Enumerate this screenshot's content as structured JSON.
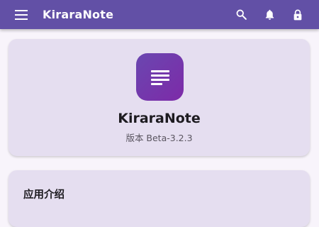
{
  "app_bar": {
    "title": "KiraraNote",
    "background": "#6250a6",
    "menu_icon": "menu-icon",
    "actions": [
      {
        "icon": "search-icon"
      },
      {
        "icon": "bell-icon"
      },
      {
        "icon": "lock-icon"
      }
    ]
  },
  "info_card": {
    "logo_icon": "notes-icon",
    "app_name": "KiraraNote",
    "version": "版本 Beta-3.2.3"
  },
  "intro_card": {
    "title": "应用介绍"
  }
}
